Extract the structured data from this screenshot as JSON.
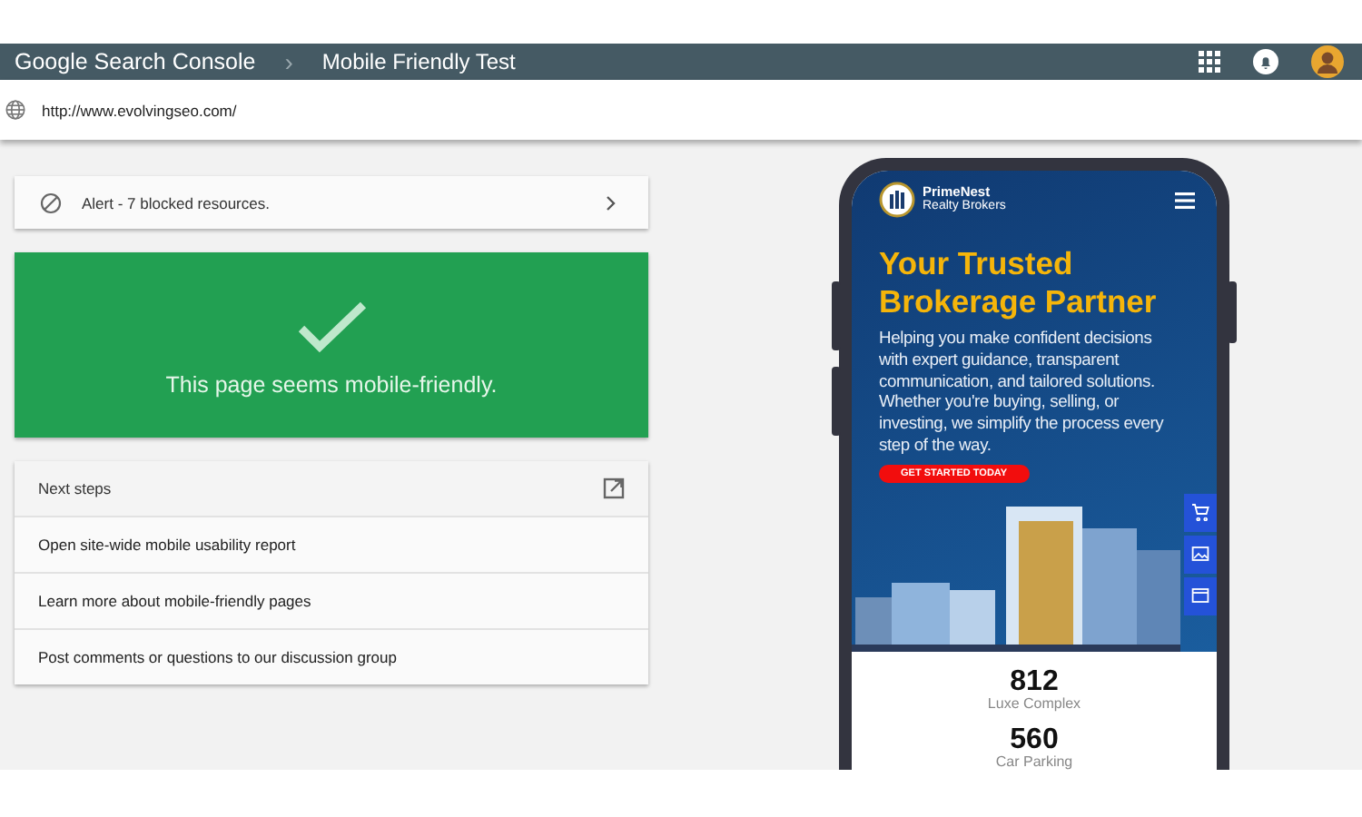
{
  "header": {
    "logo": "Google Search Console",
    "separator": "›",
    "title": "Mobile Friendly Test"
  },
  "url_bar": {
    "value": "http://www.evolvingseo.com/"
  },
  "alert": {
    "text": "Alert - 7 blocked resources."
  },
  "result": {
    "passed": true,
    "message": "This page seems mobile-friendly."
  },
  "next_steps": {
    "title": "Next steps",
    "links": [
      "Open site-wide mobile usability report",
      "Learn more about mobile-friendly pages",
      "Post comments or questions to our discussion group"
    ]
  },
  "phone_preview": {
    "brand_name": "PrimeNest",
    "brand_tagline": "Realty Brokers",
    "headline": "Your Trusted Brokerage Partner",
    "body": "Helping you make confident decisions with expert guidance, transparent communication, and tailored solutions. Whether you're buying, selling, or investing, we simplify the process every step of the way.",
    "cta": "GET STARTED TODAY",
    "stats": [
      {
        "value": "812",
        "label": "Luxe Complex"
      },
      {
        "value": "560",
        "label": "Car Parking"
      }
    ]
  }
}
